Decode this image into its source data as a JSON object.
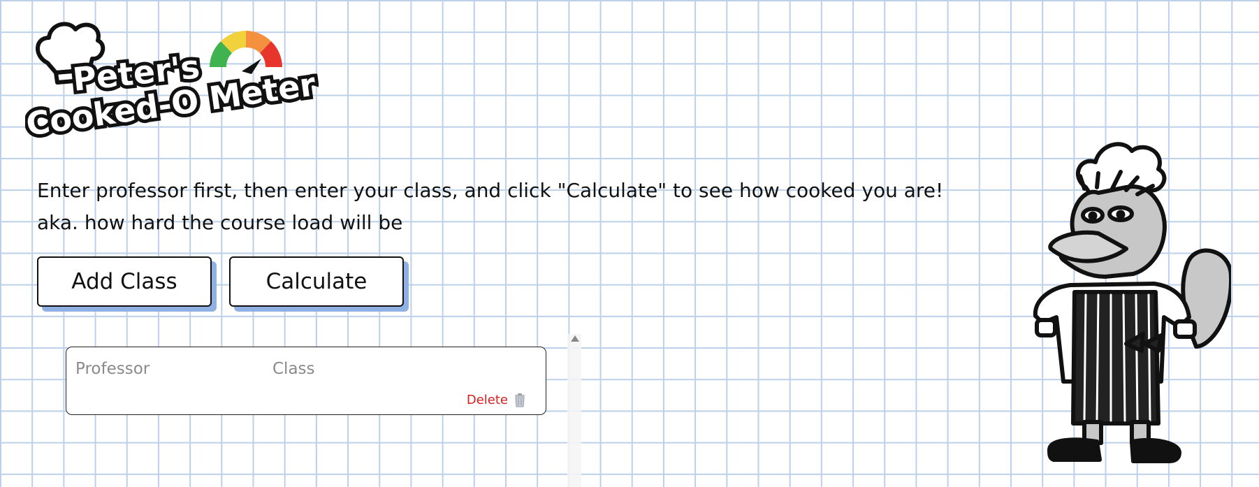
{
  "header": {
    "logo_line1": "Peter's",
    "logo_line2": "Cooked-O Meter"
  },
  "instructions": {
    "line1": "Enter professor first, then enter your class, and click \"Calculate\" to see how cooked you are!",
    "line2": "aka. how hard the course load will be"
  },
  "buttons": {
    "add_class": "Add Class",
    "calculate": "Calculate"
  },
  "class_entry": {
    "professor_placeholder": "Professor",
    "class_placeholder": "Class",
    "professor_value": "",
    "class_value": "",
    "delete_label": "Delete"
  },
  "colors": {
    "grid_line": "#bcd0ea",
    "button_shadow": "#8fb0e2",
    "delete_text": "#d61f1f",
    "gauge_green": "#3fb34f",
    "gauge_yellow": "#f2d23c",
    "gauge_orange": "#f5913e",
    "gauge_red": "#e8352b"
  },
  "icons": {
    "logo_chef_hat": "chef-hat-icon",
    "logo_gauge": "gauge-meter-icon",
    "delete": "trash-icon",
    "scroll_up": "scroll-up-arrow-icon"
  }
}
